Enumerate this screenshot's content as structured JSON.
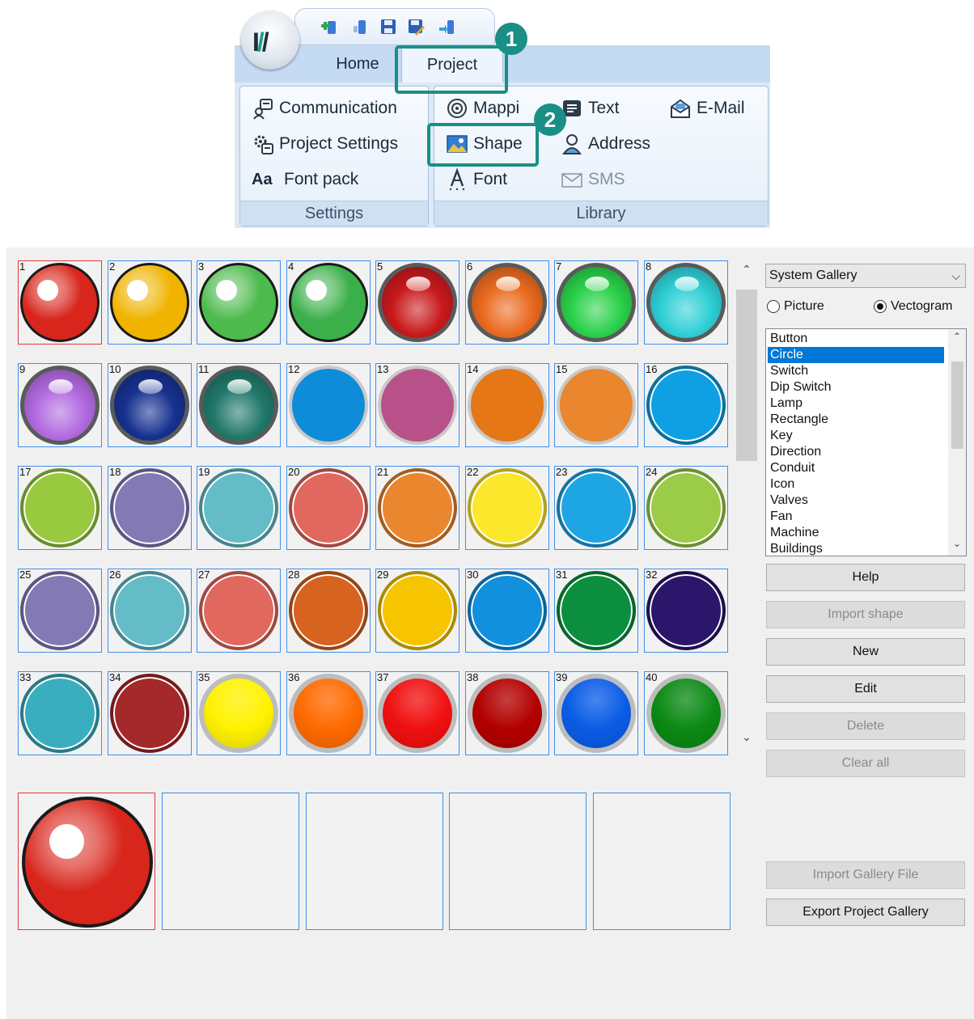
{
  "ribbon": {
    "tabs": [
      {
        "label": "Home"
      },
      {
        "label": "Project"
      }
    ],
    "settings": {
      "items": [
        {
          "label": "Communication"
        },
        {
          "label": "Project Settings"
        },
        {
          "label": "Font pack"
        }
      ],
      "group_label": "Settings"
    },
    "library": {
      "items": {
        "mapping": "Mappi",
        "text": "Text",
        "email": "E-Mail",
        "shape": "Shape",
        "address": "Address",
        "font": "Font",
        "sms": "SMS"
      },
      "group_label": "Library"
    },
    "callouts": [
      "1",
      "2"
    ],
    "accent_color": "#1a8f86"
  },
  "gallery": {
    "source_label": "System Gallery",
    "radio_options": [
      {
        "label": "Picture",
        "selected": false
      },
      {
        "label": "Vectogram",
        "selected": true
      }
    ],
    "categories": [
      "Button",
      "Circle",
      "Switch",
      "Dip Switch",
      "Lamp",
      "Rectangle",
      "Key",
      "Direction",
      "Conduit",
      "Icon",
      "Valves",
      "Fan",
      "Machine",
      "Buildings"
    ],
    "selected_category": "Circle",
    "buttons": {
      "help": "Help",
      "import_shape": "Import shape",
      "new": "New",
      "edit": "Edit",
      "delete": "Delete",
      "clear_all": "Clear all",
      "import_gallery_file": "Import Gallery File",
      "export_project_gallery": "Export Project Gallery"
    },
    "shapes": [
      {
        "n": "1",
        "color": "#d8261c",
        "style": "dome"
      },
      {
        "n": "2",
        "color": "#f0b400",
        "style": "dome"
      },
      {
        "n": "3",
        "color": "#4dba4d",
        "style": "dome"
      },
      {
        "n": "4",
        "color": "#3bb04a",
        "style": "dome"
      },
      {
        "n": "5",
        "color": "#c8191c",
        "style": "gloss"
      },
      {
        "n": "6",
        "color": "#ea6a1f",
        "style": "gloss"
      },
      {
        "n": "7",
        "color": "#2ad14a",
        "style": "gloss"
      },
      {
        "n": "8",
        "color": "#2ed0d6",
        "style": "gloss"
      },
      {
        "n": "9",
        "color": "#b26ae0",
        "style": "gloss"
      },
      {
        "n": "10",
        "color": "#16318f",
        "style": "gloss"
      },
      {
        "n": "11",
        "color": "#21786a",
        "style": "gloss"
      },
      {
        "n": "12",
        "color": "#0e8bd9",
        "style": "flat"
      },
      {
        "n": "13",
        "color": "#b85189",
        "style": "flat"
      },
      {
        "n": "14",
        "color": "#e57717",
        "style": "flat"
      },
      {
        "n": "15",
        "color": "#e9862e",
        "style": "flat"
      },
      {
        "n": "16",
        "color": "#0ea0e2",
        "style": "ring"
      },
      {
        "n": "17",
        "color": "#98c93f",
        "style": "ring"
      },
      {
        "n": "18",
        "color": "#8379b5",
        "style": "ring"
      },
      {
        "n": "19",
        "color": "#64bcc7",
        "style": "ring"
      },
      {
        "n": "20",
        "color": "#e1685e",
        "style": "ring"
      },
      {
        "n": "21",
        "color": "#e9862e",
        "style": "ring"
      },
      {
        "n": "22",
        "color": "#fbe72c",
        "style": "ring"
      },
      {
        "n": "23",
        "color": "#1ea5e4",
        "style": "ring"
      },
      {
        "n": "24",
        "color": "#9ccb48",
        "style": "ring"
      },
      {
        "n": "25",
        "color": "#8379b5",
        "style": "ring"
      },
      {
        "n": "26",
        "color": "#64bcc7",
        "style": "ring"
      },
      {
        "n": "27",
        "color": "#e1685e",
        "style": "ring"
      },
      {
        "n": "28",
        "color": "#d6631f",
        "style": "ring"
      },
      {
        "n": "29",
        "color": "#f6c500",
        "style": "ring"
      },
      {
        "n": "30",
        "color": "#1090dd",
        "style": "ring"
      },
      {
        "n": "31",
        "color": "#0b8f3e",
        "style": "ring"
      },
      {
        "n": "32",
        "color": "#2b166b",
        "style": "ring"
      },
      {
        "n": "33",
        "color": "#39aebe",
        "style": "ring"
      },
      {
        "n": "34",
        "color": "#a5282a",
        "style": "ring"
      },
      {
        "n": "35",
        "color": "#fff200",
        "style": "bezel"
      },
      {
        "n": "36",
        "color": "#ff6a00",
        "style": "bezel"
      },
      {
        "n": "37",
        "color": "#f01010",
        "style": "bezel"
      },
      {
        "n": "38",
        "color": "#b30000",
        "style": "bezel"
      },
      {
        "n": "39",
        "color": "#0a5ce6",
        "style": "bezel"
      },
      {
        "n": "40",
        "color": "#0b8a14",
        "style": "bezel"
      }
    ],
    "selected_shape": "1"
  }
}
